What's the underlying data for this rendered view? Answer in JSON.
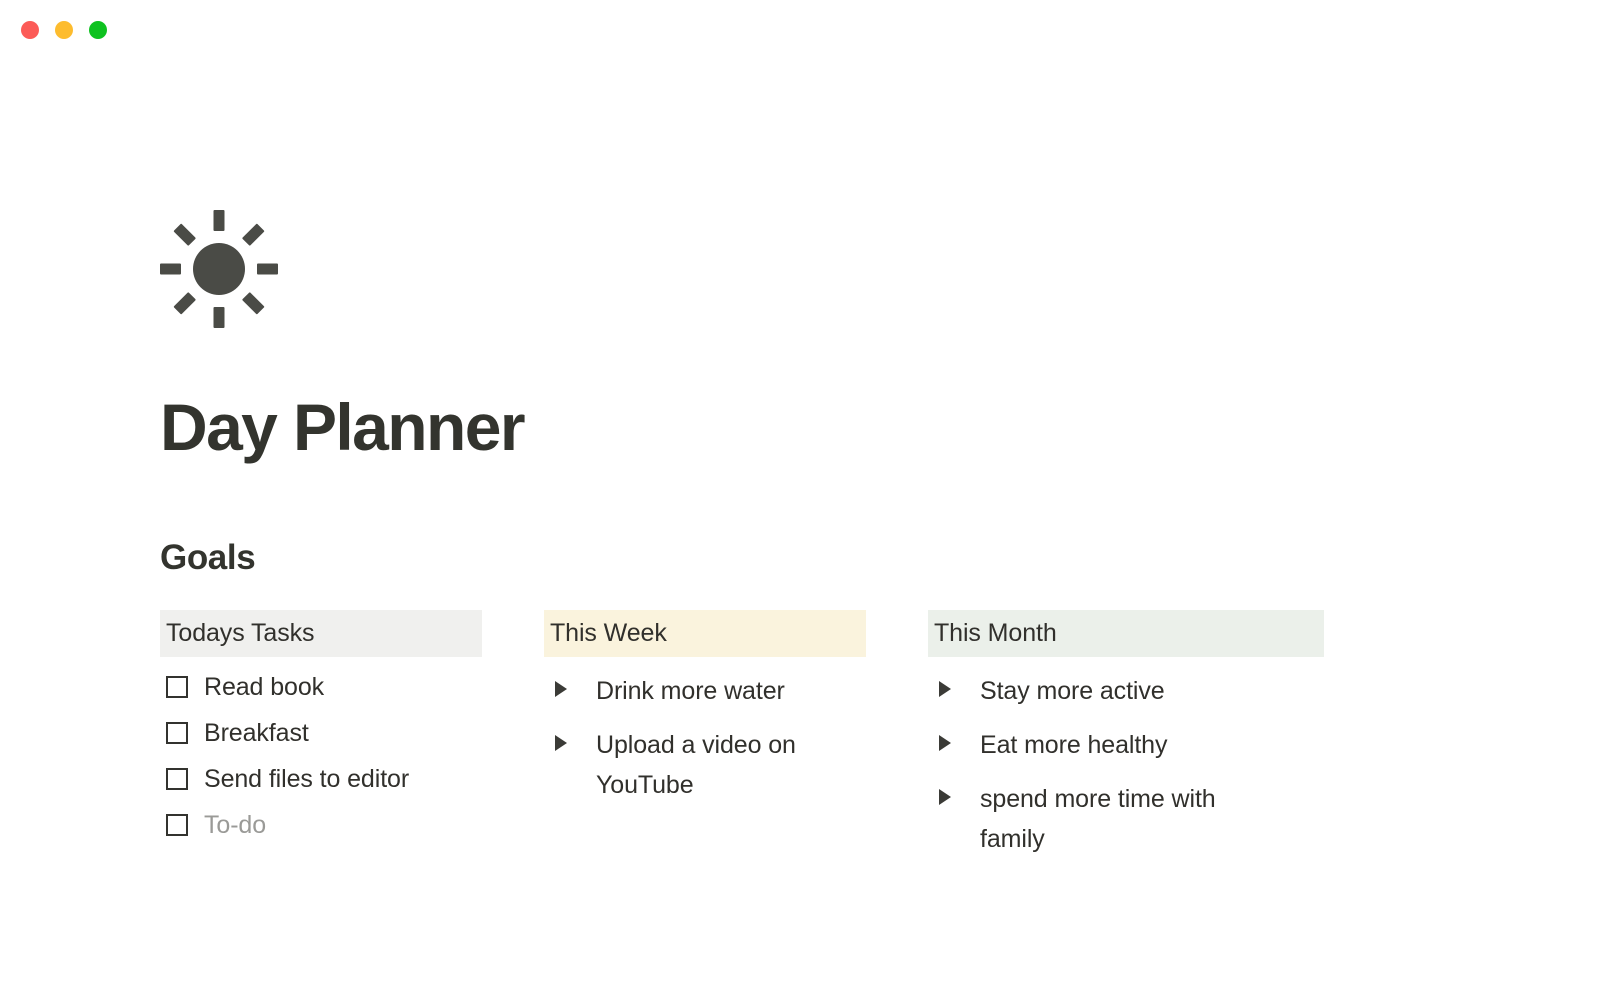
{
  "window": {
    "traffic_lights": [
      {
        "name": "close",
        "color": "#fc5b57"
      },
      {
        "name": "minimize",
        "color": "#fdbc2e"
      },
      {
        "name": "maximize",
        "color": "#0ec220"
      }
    ]
  },
  "page": {
    "icon": "sun-icon",
    "title": "Day Planner",
    "section_heading": "Goals"
  },
  "columns": [
    {
      "header": "Todays Tasks",
      "header_bg": "#f0f0ee",
      "type": "checkbox",
      "items": [
        {
          "label": "Read book",
          "checked": false,
          "placeholder": false
        },
        {
          "label": "Breakfast",
          "checked": false,
          "placeholder": false
        },
        {
          "label": "Send files to editor",
          "checked": false,
          "placeholder": false
        },
        {
          "label": "To-do",
          "checked": false,
          "placeholder": true
        }
      ]
    },
    {
      "header": "This Week",
      "header_bg": "#faf3dd",
      "type": "toggle",
      "items": [
        {
          "label": "Drink more water"
        },
        {
          "label": "Upload a video on YouTube"
        }
      ]
    },
    {
      "header": "This Month",
      "header_bg": "#ebf0ea",
      "type": "toggle",
      "items": [
        {
          "label": "Stay more active"
        },
        {
          "label": "Eat more healthy"
        },
        {
          "label": "spend more time with family"
        }
      ]
    }
  ]
}
